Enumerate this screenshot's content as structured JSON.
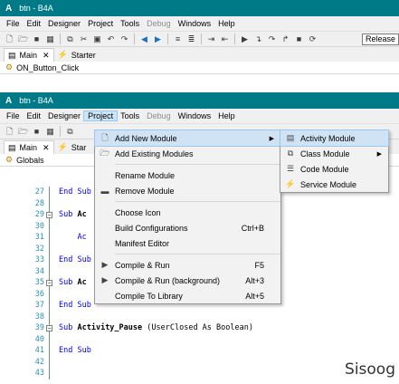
{
  "window1": {
    "title": "btn - B4A",
    "logo": "A",
    "menu": [
      "File",
      "Edit",
      "Designer",
      "Project",
      "Tools",
      "Debug",
      "Windows",
      "Help"
    ],
    "release": "Release",
    "tabs": [
      "Main",
      "Starter"
    ],
    "tab_close": "✕",
    "subbar": "ON_Button_Click"
  },
  "window2": {
    "title": "btn - B4A",
    "logo": "A",
    "menu": [
      "File",
      "Edit",
      "Designer",
      "Project",
      "Tools",
      "Debug",
      "Windows",
      "Help"
    ],
    "tabs": [
      "Main",
      "Star"
    ],
    "tab_close": "✕",
    "subbar": "Globals"
  },
  "editor": {
    "lines": [
      {
        "num": "27",
        "pre": "",
        "kw1": "End Sub",
        "name": "",
        "rest": ""
      },
      {
        "num": "28",
        "pre": "",
        "kw1": "",
        "name": "",
        "rest": ""
      },
      {
        "num": "29",
        "pre": "",
        "kw1": "Sub",
        "name": "Ac",
        "rest": ""
      },
      {
        "num": "30",
        "pre": "",
        "kw1": "",
        "name": "",
        "rest": ""
      },
      {
        "num": "31",
        "pre": "    ",
        "kw1": "Ac",
        "name": "",
        "rest": ""
      },
      {
        "num": "32",
        "pre": "",
        "kw1": "",
        "name": "",
        "rest": ""
      },
      {
        "num": "33",
        "pre": "",
        "kw1": "End Sub",
        "name": "",
        "rest": ""
      },
      {
        "num": "34",
        "pre": "",
        "kw1": "",
        "name": "",
        "rest": ""
      },
      {
        "num": "35",
        "pre": "",
        "kw1": "Sub",
        "name": "Ac",
        "rest": ""
      },
      {
        "num": "36",
        "pre": "",
        "kw1": "",
        "name": "",
        "rest": ""
      },
      {
        "num": "37",
        "pre": "",
        "kw1": "End Sub",
        "name": "",
        "rest": ""
      },
      {
        "num": "38",
        "pre": "",
        "kw1": "",
        "name": "",
        "rest": ""
      },
      {
        "num": "39",
        "pre": "",
        "kw1": "Sub",
        "name": "Activity_Pause",
        "rest": "(UserClosed As Boolean)"
      },
      {
        "num": "40",
        "pre": "",
        "kw1": "",
        "name": "",
        "rest": ""
      },
      {
        "num": "41",
        "pre": "",
        "kw1": "End Sub",
        "name": "",
        "rest": ""
      },
      {
        "num": "42",
        "pre": "",
        "kw1": "",
        "name": "",
        "rest": ""
      },
      {
        "num": "43",
        "pre": "",
        "kw1": "",
        "name": "",
        "rest": ""
      }
    ],
    "collapse_lines": [
      "29",
      "35",
      "39"
    ],
    "collapse_glyph": "−"
  },
  "project_menu": {
    "items": [
      {
        "label": "Add New Module",
        "shortcut": "",
        "submenu": true,
        "icon": "add-module-icon",
        "glyph": "🗋",
        "highlight": true
      },
      {
        "label": "Add Existing Modules",
        "shortcut": "",
        "submenu": false,
        "icon": "add-existing-icon",
        "glyph": "🗁"
      },
      {
        "sep": true
      },
      {
        "label": "Rename Module",
        "shortcut": "",
        "submenu": false,
        "icon": "",
        "glyph": ""
      },
      {
        "label": "Remove Module",
        "shortcut": "",
        "submenu": false,
        "icon": "remove-icon",
        "glyph": "▬"
      },
      {
        "sep": true
      },
      {
        "label": "Choose Icon",
        "shortcut": "",
        "submenu": false,
        "icon": "",
        "glyph": ""
      },
      {
        "label": "Build Configurations",
        "shortcut": "Ctrl+B",
        "submenu": false,
        "icon": "",
        "glyph": ""
      },
      {
        "label": "Manifest Editor",
        "shortcut": "",
        "submenu": false,
        "icon": "",
        "glyph": ""
      },
      {
        "sep": true
      },
      {
        "label": "Compile & Run",
        "shortcut": "F5",
        "submenu": false,
        "icon": "play-icon",
        "glyph": "▶"
      },
      {
        "label": "Compile & Run (background)",
        "shortcut": "Alt+3",
        "submenu": false,
        "icon": "play-icon",
        "glyph": "▶"
      },
      {
        "label": "Compile To Library",
        "shortcut": "Alt+5",
        "submenu": false,
        "icon": "",
        "glyph": ""
      }
    ]
  },
  "module_submenu": {
    "items": [
      {
        "label": "Activity Module",
        "submenu": false,
        "icon": "activity-icon",
        "glyph": "▤",
        "highlight": true
      },
      {
        "label": "Class Module",
        "submenu": true,
        "icon": "class-icon",
        "glyph": "⧉"
      },
      {
        "label": "Code Module",
        "submenu": false,
        "icon": "code-icon",
        "glyph": "☰"
      },
      {
        "label": "Service Module",
        "submenu": false,
        "icon": "service-icon",
        "glyph": "⚡"
      }
    ]
  },
  "watermark": "Sisoog",
  "colors": {
    "titlebar": "#007a87",
    "keyword": "#0000ff",
    "line_number": "#2b91af",
    "menu_highlight": "#cfe3f5"
  }
}
